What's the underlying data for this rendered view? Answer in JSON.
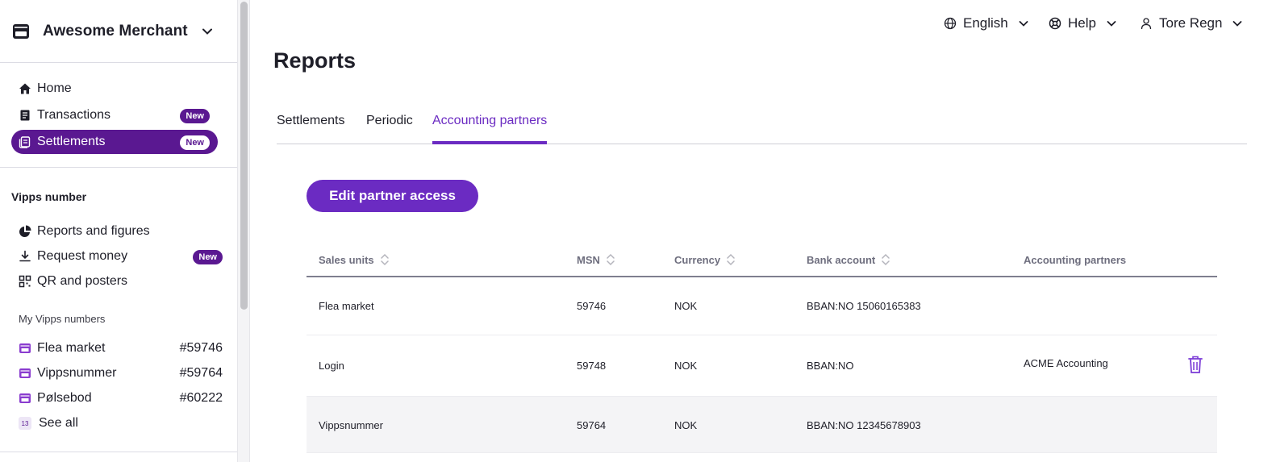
{
  "merchant": {
    "name": "Awesome Merchant"
  },
  "nav": [
    {
      "label": "Home",
      "icon": "home-icon"
    },
    {
      "label": "Transactions",
      "icon": "receipt-icon",
      "badge": "New"
    },
    {
      "label": "Settlements",
      "icon": "settlement-icon",
      "badge": "New",
      "active": true
    }
  ],
  "vipps_section": {
    "title": "Vipps number",
    "items": [
      {
        "label": "Reports and figures",
        "icon": "pie-chart-icon"
      },
      {
        "label": "Request money",
        "icon": "download-icon",
        "badge": "New"
      },
      {
        "label": "QR and posters",
        "icon": "qr-icon"
      }
    ],
    "my_numbers_title": "My Vipps numbers",
    "numbers": [
      {
        "label": "Flea market",
        "number": "#59746"
      },
      {
        "label": "Vippsnummer",
        "number": "#59764"
      },
      {
        "label": "Pølsebod",
        "number": "#60222"
      }
    ],
    "see_all_count": "13",
    "see_all_label": "See all"
  },
  "topbar": {
    "language": "English",
    "help": "Help",
    "user": "Tore Regn"
  },
  "page": {
    "title": "Reports",
    "tabs": [
      "Settlements",
      "Periodic",
      "Accounting partners"
    ],
    "active_tab": "Accounting partners",
    "edit_button": "Edit partner access"
  },
  "table": {
    "columns": [
      "Sales units",
      "MSN",
      "Currency",
      "Bank account",
      "Accounting partners"
    ],
    "rows": [
      {
        "sales_unit": "Flea market",
        "msn": "59746",
        "currency": "NOK",
        "bank_account": "BBAN:NO 15060165383",
        "partner": ""
      },
      {
        "sales_unit": "Login",
        "msn": "59748",
        "currency": "NOK",
        "bank_account": "BBAN:NO",
        "partner": "ACME Accounting"
      },
      {
        "sales_unit": "Vippsnummer",
        "msn": "59764",
        "currency": "NOK",
        "bank_account": "BBAN:NO 12345678903",
        "partner": ""
      }
    ]
  },
  "colors": {
    "brand_purple": "#6b2bc2",
    "active_nav": "#5a1891"
  }
}
